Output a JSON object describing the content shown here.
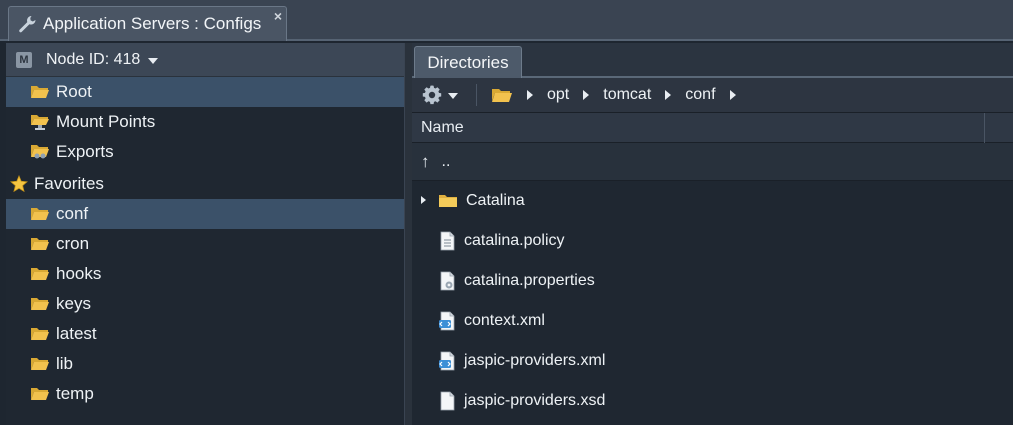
{
  "window_tab": {
    "title": "Application Servers : Configs",
    "close_label": "×"
  },
  "left_panel": {
    "node_label": "Node ID: 418",
    "badge": "M",
    "roots": [
      {
        "label": "Root",
        "selected": true
      },
      {
        "label": "Mount Points",
        "selected": false
      },
      {
        "label": "Exports",
        "selected": false
      }
    ],
    "favorites_label": "Favorites",
    "favorites": [
      {
        "label": "conf",
        "selected": true
      },
      {
        "label": "cron",
        "selected": false
      },
      {
        "label": "hooks",
        "selected": false
      },
      {
        "label": "keys",
        "selected": false
      },
      {
        "label": "latest",
        "selected": false
      },
      {
        "label": "lib",
        "selected": false
      },
      {
        "label": "temp",
        "selected": false
      }
    ]
  },
  "right_panel": {
    "tab_label": "Directories",
    "breadcrumb": [
      "opt",
      "tomcat",
      "conf"
    ],
    "column_name": "Name",
    "up_label": "..",
    "files": [
      {
        "name": "Catalina",
        "icon": "folder-icon",
        "expandable": true
      },
      {
        "name": "catalina.policy",
        "icon": "file-icon",
        "expandable": false
      },
      {
        "name": "catalina.properties",
        "icon": "properties-file-icon",
        "expandable": false
      },
      {
        "name": "context.xml",
        "icon": "xml-file-icon",
        "expandable": false
      },
      {
        "name": "jaspic-providers.xml",
        "icon": "xml-file-icon",
        "expandable": false
      },
      {
        "name": "jaspic-providers.xsd",
        "icon": "blank-file-icon",
        "expandable": false
      }
    ]
  },
  "colors": {
    "selection": "#3b5169",
    "folder": "#f2c24e",
    "background": "#1f2731"
  }
}
